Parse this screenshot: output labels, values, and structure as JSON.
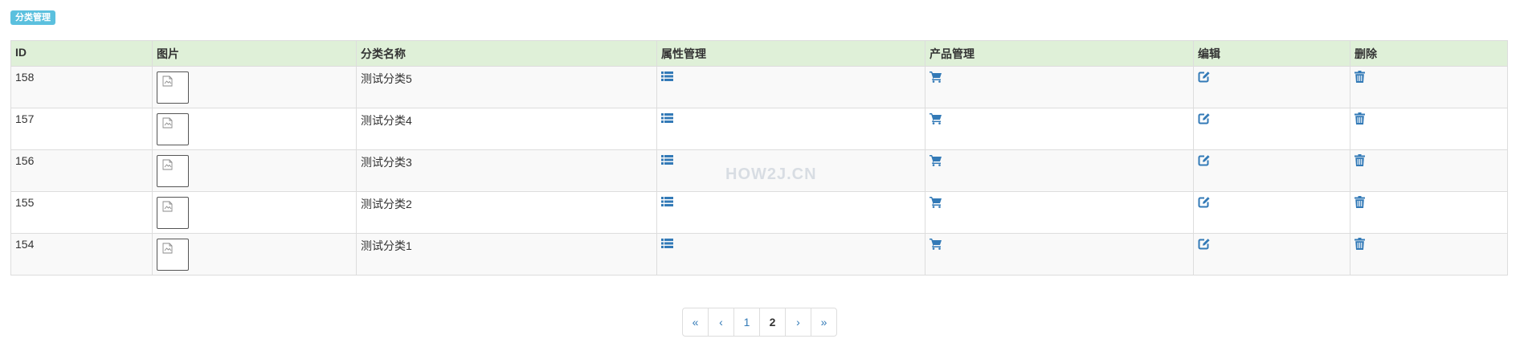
{
  "header": {
    "badge": "分类管理"
  },
  "table": {
    "columns": [
      "ID",
      "图片",
      "分类名称",
      "属性管理",
      "产品管理",
      "编辑",
      "删除"
    ],
    "rows": [
      {
        "id": "158",
        "name": "测试分类5"
      },
      {
        "id": "157",
        "name": "测试分类4"
      },
      {
        "id": "156",
        "name": "测试分类3"
      },
      {
        "id": "155",
        "name": "测试分类2"
      },
      {
        "id": "154",
        "name": "测试分类1"
      }
    ]
  },
  "icons": {
    "property": "list-icon",
    "product": "cart-icon",
    "edit": "edit-icon",
    "delete": "trash-icon",
    "image": "broken-image-icon"
  },
  "colors": {
    "header_bg": "#dff0d8",
    "badge_bg": "#5bc0de",
    "link": "#337ab7"
  },
  "watermark": "HOW2J.CN",
  "pagination": {
    "first": "«",
    "prev": "‹",
    "pages": [
      "1",
      "2"
    ],
    "current": "2",
    "next": "›",
    "last": "»"
  }
}
